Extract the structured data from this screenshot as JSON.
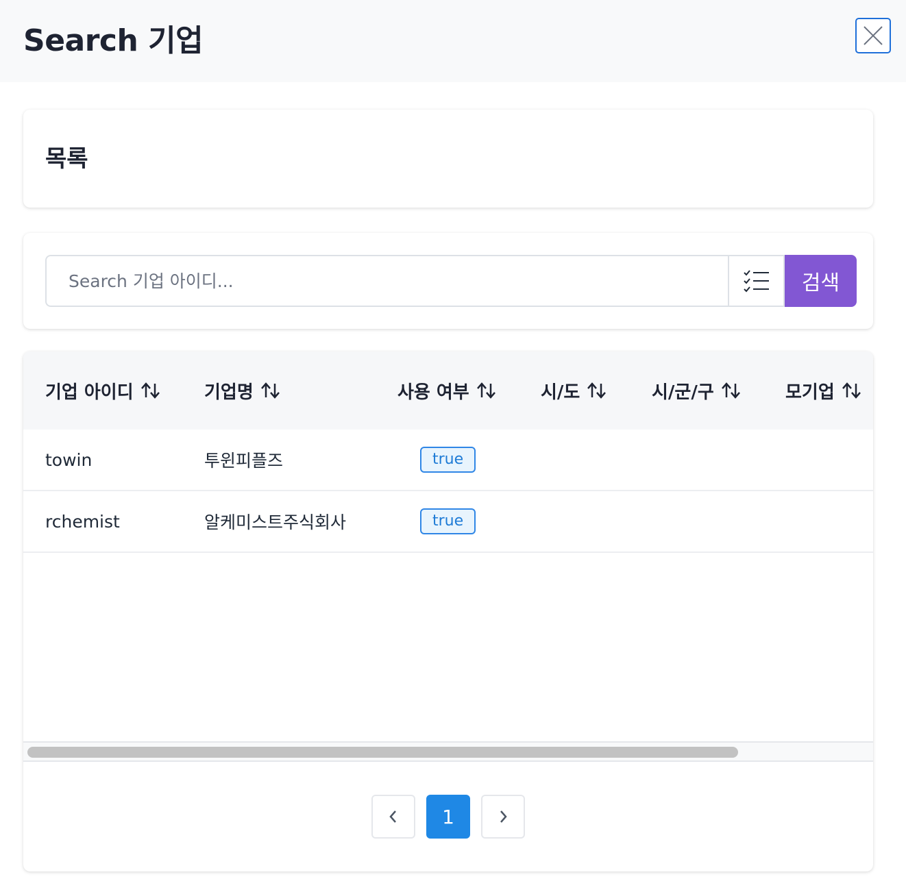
{
  "dialog": {
    "title": "Search 기업",
    "close_icon": "close-icon"
  },
  "list_card": {
    "title": "목록"
  },
  "search": {
    "placeholder": "Search 기업 아이디...",
    "value": "",
    "filter_icon": "checklist-icon",
    "button_label": "검색",
    "button_color": "#8257d3"
  },
  "table": {
    "columns": [
      {
        "label": "기업 아이디",
        "sort_icon": "sort-icon"
      },
      {
        "label": "기업명",
        "sort_icon": "sort-icon"
      },
      {
        "label": "사용 여부",
        "sort_icon": "sort-icon"
      },
      {
        "label": "시/도",
        "sort_icon": "sort-icon"
      },
      {
        "label": "시/군/구",
        "sort_icon": "sort-icon"
      },
      {
        "label": "모기업",
        "sort_icon": "sort-icon"
      }
    ],
    "rows": [
      {
        "id": "towin",
        "name": "투윈피플즈",
        "active": "true",
        "sido": "",
        "sigungu": "",
        "parent": ""
      },
      {
        "id": "rchemist",
        "name": "알케미스트주식회사",
        "active": "true",
        "sido": "",
        "sigungu": "",
        "parent": ""
      }
    ]
  },
  "pagination": {
    "prev_icon": "chevron-left-icon",
    "current_page": "1",
    "next_icon": "chevron-right-icon",
    "active_color": "#1f88e5"
  }
}
